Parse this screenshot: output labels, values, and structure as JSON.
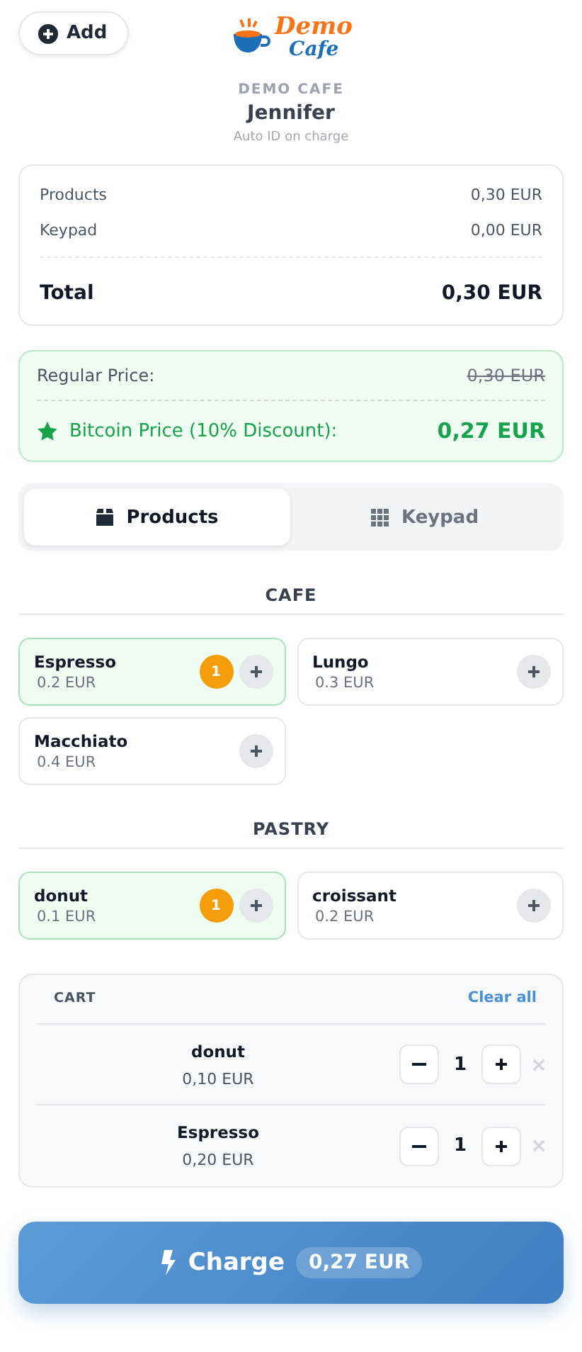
{
  "header": {
    "add_button": "Add",
    "logo": {
      "line_1": "Demo",
      "line_2": "Cafe"
    },
    "store": "DEMO CAFE",
    "customer": "Jennifer",
    "note": "Auto ID on charge"
  },
  "summary": {
    "rows": [
      {
        "label": "Products",
        "value": "0,30 EUR"
      },
      {
        "label": "Keypad",
        "value": "0,00 EUR"
      }
    ],
    "total_label": "Total",
    "total_value": "0,30 EUR"
  },
  "discount": {
    "regular_label": "Regular Price:",
    "regular_value": "0,30 EUR",
    "bitcoin_label": "Bitcoin Price (10% Discount):",
    "bitcoin_value": "0,27 EUR"
  },
  "tabs": [
    {
      "label": "Products",
      "kind": "box",
      "selected": true
    },
    {
      "label": "Keypad",
      "kind": "grid",
      "selected": false
    }
  ],
  "categories": [
    {
      "title": "CAFE",
      "products": [
        {
          "name": "Espresso",
          "price": "0.2 EUR",
          "selected": true,
          "count": "1"
        },
        {
          "name": "Lungo",
          "price": "0.3 EUR",
          "selected": false
        },
        {
          "name": "Macchiato",
          "price": "0.4 EUR",
          "selected": false
        }
      ]
    },
    {
      "title": "PASTRY",
      "products": [
        {
          "name": "donut",
          "price": "0.1 EUR",
          "selected": true,
          "count": "1"
        },
        {
          "name": "croissant",
          "price": "0.2 EUR",
          "selected": false
        }
      ]
    }
  ],
  "cart": {
    "title": "CART",
    "clear": "Clear all",
    "items": [
      {
        "name": "donut",
        "price": "0,10 EUR",
        "quantity": "1"
      },
      {
        "name": "Espresso",
        "price": "0,20 EUR",
        "quantity": "1"
      }
    ]
  },
  "charge": {
    "label": "Charge",
    "amount": "0,27 EUR"
  }
}
